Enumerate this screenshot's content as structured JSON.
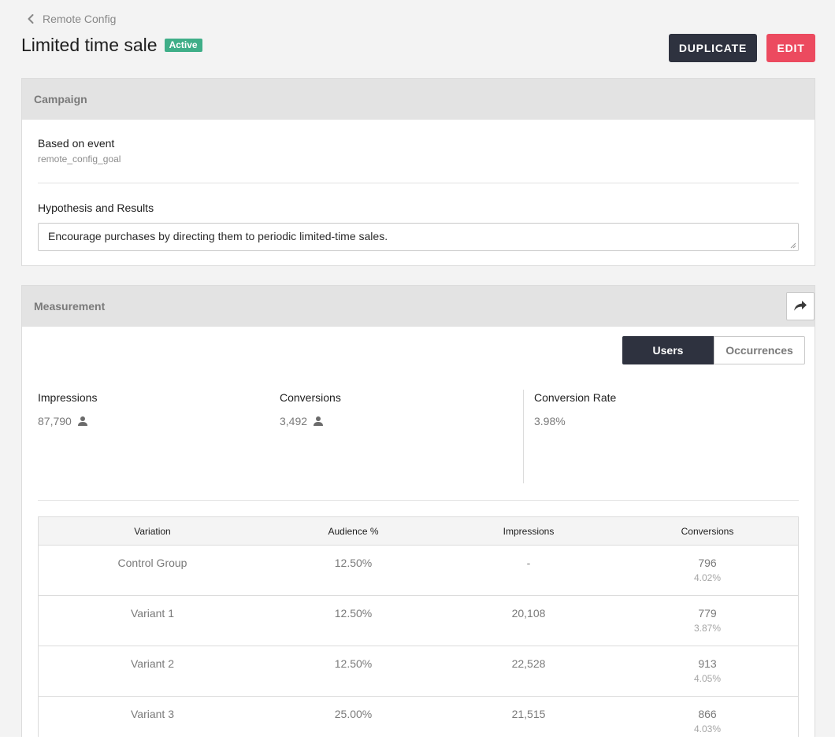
{
  "breadcrumb": {
    "label": "Remote Config"
  },
  "header": {
    "title": "Limited time sale",
    "status_badge": "Active",
    "duplicate_label": "DUPLICATE",
    "edit_label": "EDIT"
  },
  "campaign": {
    "section_title": "Campaign",
    "event_label": "Based on event",
    "event_value": "remote_config_goal",
    "hypothesis_label": "Hypothesis and Results",
    "hypothesis_value": "Encourage purchases by directing them to periodic limited-time sales."
  },
  "measurement": {
    "section_title": "Measurement",
    "toggle": {
      "users": "Users",
      "occurrences": "Occurrences",
      "selected": "Users"
    },
    "stats": {
      "impressions_label": "Impressions",
      "impressions_value": "87,790",
      "conversions_label": "Conversions",
      "conversions_value": "3,492",
      "rate_label": "Conversion Rate",
      "rate_value": "3.98%"
    },
    "table": {
      "headers": [
        "Variation",
        "Audience %",
        "Impressions",
        "Conversions"
      ],
      "rows": [
        {
          "variation": "Control Group",
          "audience": "12.50%",
          "impressions": "-",
          "conversions": "796",
          "rate": "4.02%"
        },
        {
          "variation": "Variant 1",
          "audience": "12.50%",
          "impressions": "20,108",
          "conversions": "779",
          "rate": "3.87%"
        },
        {
          "variation": "Variant 2",
          "audience": "12.50%",
          "impressions": "22,528",
          "conversions": "913",
          "rate": "4.05%"
        },
        {
          "variation": "Variant 3",
          "audience": "25.00%",
          "impressions": "21,515",
          "conversions": "866",
          "rate": "4.03%"
        }
      ]
    }
  },
  "colors": {
    "accent_dark": "#2e323f",
    "edit_red": "#ec4a5f",
    "active_green": "#3fae88"
  },
  "icons": [
    "chevron-left-icon",
    "user-icon",
    "share-icon"
  ]
}
